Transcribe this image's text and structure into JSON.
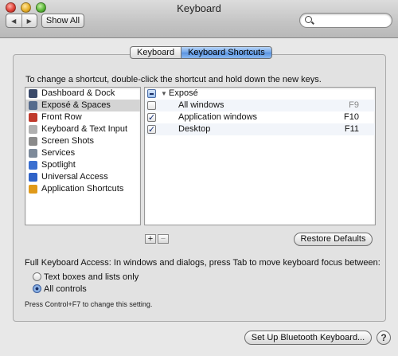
{
  "window": {
    "title": "Keyboard"
  },
  "toolbar": {
    "back_icon": "◀",
    "forward_icon": "▶",
    "show_all_label": "Show All",
    "search_placeholder": "",
    "search_value": ""
  },
  "tabs": [
    {
      "label": "Keyboard",
      "active": false
    },
    {
      "label": "Keyboard Shortcuts",
      "active": true
    }
  ],
  "instructions": "To change a shortcut, double-click the shortcut and hold down the new keys.",
  "categories": [
    {
      "label": "Dashboard & Dock",
      "icon": "dashboard-dock-icon",
      "color": "#3a4a6a",
      "selected": false
    },
    {
      "label": "Exposé & Spaces",
      "icon": "expose-spaces-icon",
      "color": "#556b8c",
      "selected": true
    },
    {
      "label": "Front Row",
      "icon": "front-row-icon",
      "color": "#c0392b",
      "selected": false
    },
    {
      "label": "Keyboard & Text Input",
      "icon": "keyboard-text-icon",
      "color": "#b0b0b0",
      "selected": false
    },
    {
      "label": "Screen Shots",
      "icon": "screen-shots-icon",
      "color": "#8a8a8a",
      "selected": false
    },
    {
      "label": "Services",
      "icon": "services-icon",
      "color": "#7d8a9a",
      "selected": false
    },
    {
      "label": "Spotlight",
      "icon": "spotlight-icon",
      "color": "#3a6fd0",
      "selected": false
    },
    {
      "label": "Universal Access",
      "icon": "universal-access-icon",
      "color": "#2f63c8",
      "selected": false
    },
    {
      "label": "Application Shortcuts",
      "icon": "application-shortcuts-icon",
      "color": "#e09a1a",
      "selected": false
    }
  ],
  "shortcut_group": {
    "label": "Exposé",
    "state": "mixed"
  },
  "shortcuts": [
    {
      "name": "All windows",
      "key": "F9",
      "checked": false
    },
    {
      "name": "Application windows",
      "key": "F10",
      "checked": true
    },
    {
      "name": "Desktop",
      "key": "F11",
      "checked": true
    }
  ],
  "list_controls": {
    "add_label": "+",
    "remove_label": "−"
  },
  "restore_label": "Restore Defaults",
  "full_keyboard_access": {
    "label": "Full Keyboard Access: In windows and dialogs, press Tab to move keyboard focus between:",
    "options": [
      {
        "label": "Text boxes and lists only",
        "selected": false
      },
      {
        "label": "All controls",
        "selected": true
      }
    ],
    "hint": "Press Control+F7 to change this setting."
  },
  "bluetooth_button_label": "Set Up Bluetooth Keyboard...",
  "help_label": "?",
  "checkmark_glyph": "✓"
}
